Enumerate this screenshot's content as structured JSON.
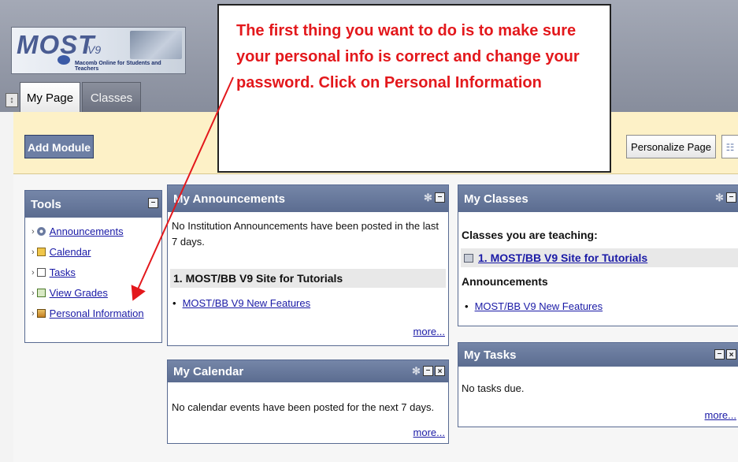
{
  "logo": {
    "most": "MOST",
    "version": "V9",
    "subtitle": "Macomb Online for Students and Teachers"
  },
  "tabs": [
    {
      "label": "My Page",
      "active": true
    },
    {
      "label": "Classes",
      "active": false
    }
  ],
  "toolbar": {
    "add_module": "Add Module",
    "personalize": "Personalize Page",
    "grid_icon": "layout-icon"
  },
  "tools": {
    "title": "Tools",
    "items": [
      {
        "label": "Announcements",
        "icon": "announcement-icon"
      },
      {
        "label": "Calendar",
        "icon": "calendar-icon"
      },
      {
        "label": "Tasks",
        "icon": "tasks-icon"
      },
      {
        "label": "View Grades",
        "icon": "grades-icon"
      },
      {
        "label": "Personal Information",
        "icon": "personal-info-icon"
      }
    ]
  },
  "announcements": {
    "title": "My Announcements",
    "empty_text": "No Institution Announcements have been posted in the last 7 days.",
    "course": "1. MOST/BB V9 Site for Tutorials",
    "item": "MOST/BB V9 New Features",
    "more": "more..."
  },
  "calendar": {
    "title": "My Calendar",
    "empty_text": "No calendar events have been posted for the next 7 days.",
    "more": "more..."
  },
  "classes": {
    "title": "My Classes",
    "teaching_label": "Classes you are teaching:",
    "course": "1. MOST/BB V9 Site for Tutorials",
    "announcements_label": "Announcements",
    "item": "MOST/BB V9 New Features"
  },
  "tasks": {
    "title": "My Tasks",
    "empty_text": "No tasks due.",
    "more": "more..."
  },
  "callout": {
    "text": "The first thing you want to do is to make sure your personal info is correct and change your password. Click on Personal Information"
  },
  "colors": {
    "callout_text": "#e3181c",
    "module_header": "#5b6c90",
    "toolbar_bg": "#fdf1c7"
  }
}
